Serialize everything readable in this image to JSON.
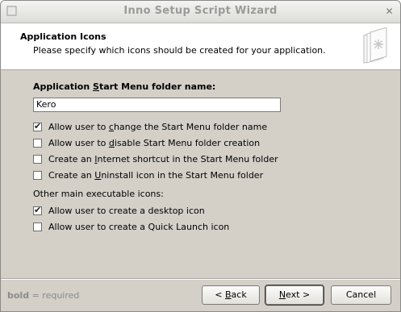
{
  "window": {
    "title": "Inno Setup Script Wizard",
    "close_glyph": "✕"
  },
  "header": {
    "title": "Application Icons",
    "subtitle": "Please specify which icons should be created for your application."
  },
  "form": {
    "folder_label_pre": "Application ",
    "folder_label_ul": "S",
    "folder_label_post": "tart Menu folder name:",
    "folder_value": "Kero",
    "options": [
      {
        "checked": true,
        "pre": "Allow user to ",
        "ul": "c",
        "post": "hange the Start Menu folder name"
      },
      {
        "checked": false,
        "pre": "Allow user to ",
        "ul": "d",
        "post": "isable Start Menu folder creation"
      },
      {
        "checked": false,
        "pre": "Create an ",
        "ul": "I",
        "post": "nternet shortcut in the Start Menu folder"
      },
      {
        "checked": false,
        "pre": "Create an ",
        "ul": "U",
        "post": "ninstall icon in the Start Menu folder"
      }
    ],
    "other_label": "Other main executable icons:",
    "other_options": [
      {
        "checked": true,
        "pre": "Allow user to create a desktop icon",
        "ul": "",
        "post": ""
      },
      {
        "checked": false,
        "pre": "Allow user to create a Quick Launch icon",
        "ul": "",
        "post": ""
      }
    ]
  },
  "footer": {
    "legend_bold": "bold",
    "legend_rest": " = required",
    "back": {
      "pre": "< ",
      "ul": "B",
      "post": "ack"
    },
    "next": {
      "pre": "",
      "ul": "N",
      "post": "ext >"
    },
    "cancel": "Cancel"
  },
  "colors": {
    "face": "#d4d0c8",
    "header_bg": "#ffffff",
    "muted_text": "#8a8a8a"
  }
}
